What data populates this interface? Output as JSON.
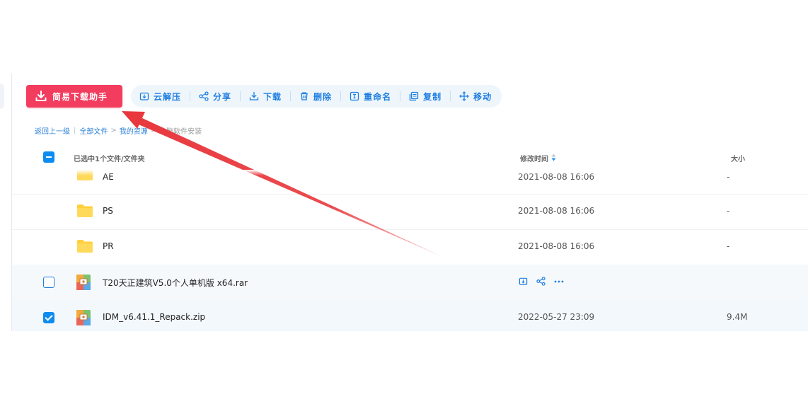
{
  "toolbar": {
    "primary_label": "简易下载助手",
    "actions": [
      {
        "label": "云解压",
        "icon": "cloud-extract-icon"
      },
      {
        "label": "分享",
        "icon": "share-icon"
      },
      {
        "label": "下载",
        "icon": "download-icon"
      },
      {
        "label": "删除",
        "icon": "trash-icon"
      },
      {
        "label": "重命名",
        "icon": "rename-icon"
      },
      {
        "label": "复制",
        "icon": "copy-icon"
      },
      {
        "label": "移动",
        "icon": "move-icon"
      }
    ]
  },
  "breadcrumb": {
    "back": "返回上一级",
    "separator": "|",
    "items": [
      "全部文件",
      "我的资源",
      "电脑软件安装"
    ],
    "arrow": ">"
  },
  "table": {
    "selection_info": "已选中1个文件/文件夹",
    "col_time": "修改时间",
    "col_size": "大小",
    "rows": [
      {
        "name": "AE",
        "time": "2021-08-08 16:06",
        "size": "-",
        "type": "folder"
      },
      {
        "name": "PS",
        "time": "2021-08-08 16:06",
        "size": "-",
        "type": "folder"
      },
      {
        "name": "PR",
        "time": "2021-08-08 16:06",
        "size": "-",
        "type": "folder"
      },
      {
        "name": "T20天正建筑V5.0个人单机版 x64.rar",
        "time": "",
        "size": "",
        "type": "archive"
      },
      {
        "name": "IDM_v6.41.1_Repack.zip",
        "time": "2022-05-27 23:09",
        "size": "9.4M",
        "type": "archive"
      }
    ]
  },
  "colors": {
    "primary": "#f23d5f",
    "accent": "#1e7ee0",
    "checkbox": "#0d8cf0",
    "folder": "#ffcf3d",
    "annotation_arrow": "#e8383d"
  }
}
